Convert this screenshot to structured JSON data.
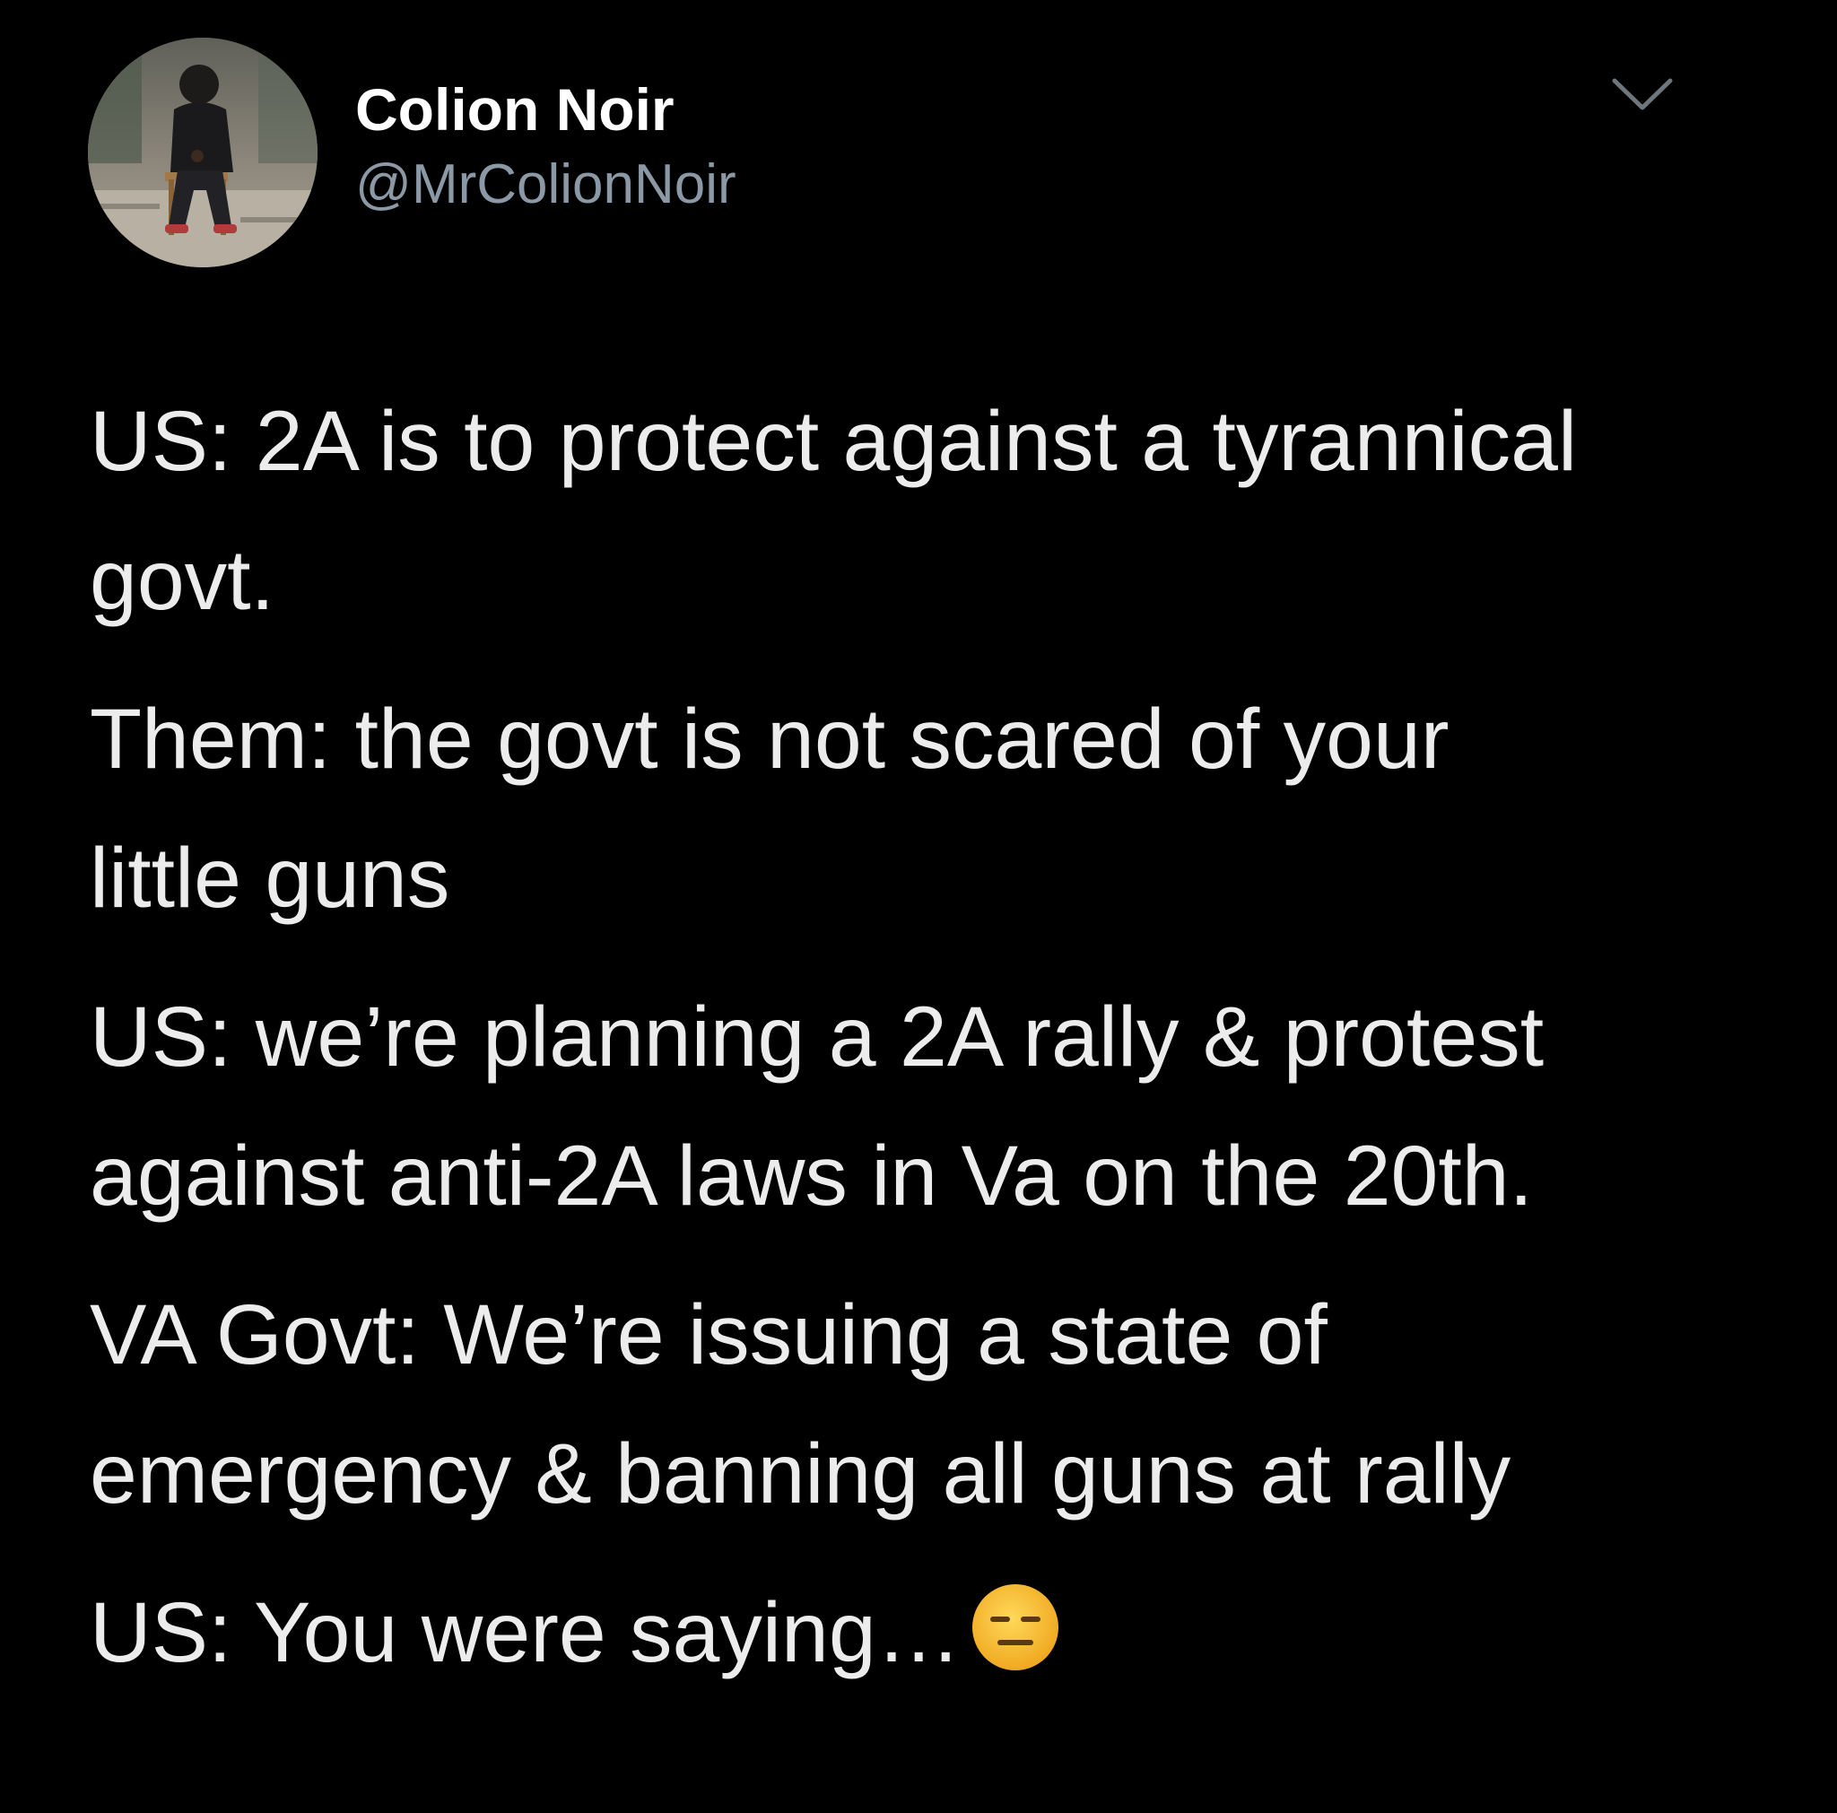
{
  "author": {
    "display_name": "Colion Noir",
    "handle": "@MrColionNoir"
  },
  "tweet": {
    "paragraphs": [
      [
        "US: 2A is to protect against a tyrannical",
        "govt."
      ],
      [
        "Them: the govt is not scared of your",
        "little guns"
      ],
      [
        "US: we’re planning a 2A rally & protest",
        "against anti-2A laws in Va on the 20th."
      ],
      [
        "VA Govt: We’re issuing a state of",
        "emergency & banning all guns at rally"
      ],
      [
        "US: You were saying…"
      ]
    ],
    "trailing_emoji": "expressionless-face-icon"
  },
  "colors": {
    "background": "#000000",
    "text": "#ececec",
    "display_name": "#ffffff",
    "handle": "#8b98a5",
    "chevron": "#6e767d",
    "emoji_face": "#f7c23a"
  },
  "icons": [
    "avatar-photo",
    "chevron-down-icon",
    "expressionless-face-icon"
  ]
}
